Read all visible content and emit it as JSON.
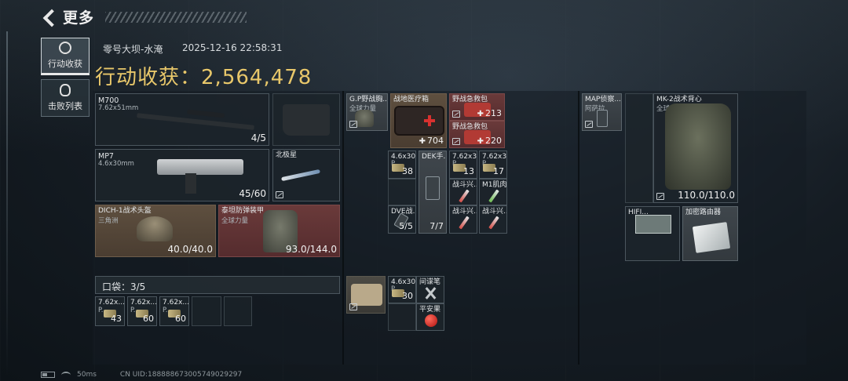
{
  "nav": {
    "back_title": "更多"
  },
  "tabs": [
    {
      "label": "行动收获",
      "icon": "target-icon",
      "active": true
    },
    {
      "label": "击败列表",
      "icon": "skull-icon",
      "active": false
    }
  ],
  "header": {
    "map": "零号大坝-水淹",
    "datetime": "2025-12-16 22:58:31",
    "haul_label": "行动收获：",
    "haul_value": "2,564,478",
    "haul_color": "#e8c76a"
  },
  "loadout": {
    "primary": {
      "name": "M700",
      "caliber": "7.62x51mm",
      "count": "4/5"
    },
    "secondary": {
      "name": "MP7",
      "caliber": "4.6x30mm",
      "count": "45/60"
    },
    "melee": {
      "name": "北极星"
    },
    "helmet": {
      "name": "DICH-1战术头盔",
      "brand": "三角洲",
      "durability": "40.0/40.0"
    },
    "armor": {
      "name": "泰坦防弹装甲",
      "brand": "全球力量",
      "durability": "93.0/144.0"
    },
    "pockets_label": "口袋：3/5",
    "pockets": [
      {
        "name": "7.62x...",
        "sub": "P...",
        "count": "43"
      },
      {
        "name": "7.62x...",
        "sub": "P...",
        "count": "60"
      },
      {
        "name": "7.62x...",
        "sub": "P...",
        "count": "60"
      }
    ]
  },
  "chest_rig": {
    "items": [
      {
        "name": "G.P野战胸...",
        "sub": "全球力量"
      },
      {
        "name": "战地医疗箱",
        "count": "704"
      },
      {
        "name": "野战急救包",
        "count": "213"
      },
      {
        "name": "野战急救包",
        "count": "220"
      },
      {
        "name": "4.6x30",
        "sub": "P...",
        "count": "38"
      },
      {
        "name": "DEK手...",
        "count": "7/7"
      },
      {
        "name": "7.62x3...",
        "sub": "P...",
        "count": "13"
      },
      {
        "name": "7.62x3...",
        "sub": "P...",
        "count": "17"
      },
      {
        "name": "战斗兴..."
      },
      {
        "name": "M1肌肉..."
      },
      {
        "name": "DVE战...",
        "count": "5/5"
      },
      {
        "name": "战斗兴..."
      },
      {
        "name": "战斗兴..."
      }
    ],
    "lower": [
      {
        "name": "4.6x30",
        "sub": "P...",
        "count": "30"
      },
      {
        "name": "间谍笔"
      },
      {
        "name": "平安果"
      }
    ]
  },
  "backpack": {
    "items": [
      {
        "name": "MAP侦察...",
        "sub": "阿萨拉"
      },
      {
        "name": "MK-2战术背心",
        "sub": "全球力量",
        "durability": "110.0/110.0"
      },
      {
        "name": "HIFI..."
      },
      {
        "name": "加密路由器"
      }
    ]
  },
  "footer": {
    "ping": "50ms",
    "uid": "CN UID:18888867300574902929​7"
  }
}
